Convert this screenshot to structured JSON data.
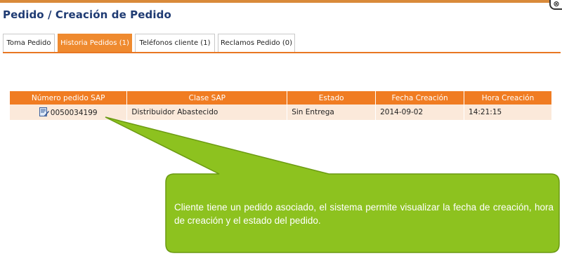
{
  "window": {
    "title": "Pedido / Creación de Pedido",
    "close_glyph": "⊗"
  },
  "tabs": [
    {
      "label": "Toma Pedido",
      "active": false
    },
    {
      "label": "Historia Pedidos (1)",
      "active": true
    },
    {
      "label": "Teléfonos cliente (1)",
      "active": false
    },
    {
      "label": "Reclamos Pedido (0)",
      "active": false
    }
  ],
  "table": {
    "headers": [
      "Número pedido SAP",
      "Clase SAP",
      "Estado",
      "Fecha Creación",
      "Hora Creación"
    ],
    "rows": [
      {
        "icon": "edit-document-icon",
        "numero": "0050034199",
        "clase": "Distribuidor Abastecido",
        "estado": "Sin Entrega",
        "fecha": "2014-09-02",
        "hora": "14:21:15"
      }
    ]
  },
  "callout": {
    "text": "Cliente tiene un pedido asociado, el sistema permite visualizar la fecha de creación, hora de creación y el estado del pedido.",
    "fill_color": "#8dc21f",
    "border_color": "#6b9a12"
  },
  "colors": {
    "accent": "#f07c22",
    "title": "#1f3b73",
    "row_bg": "#fbe9da"
  }
}
